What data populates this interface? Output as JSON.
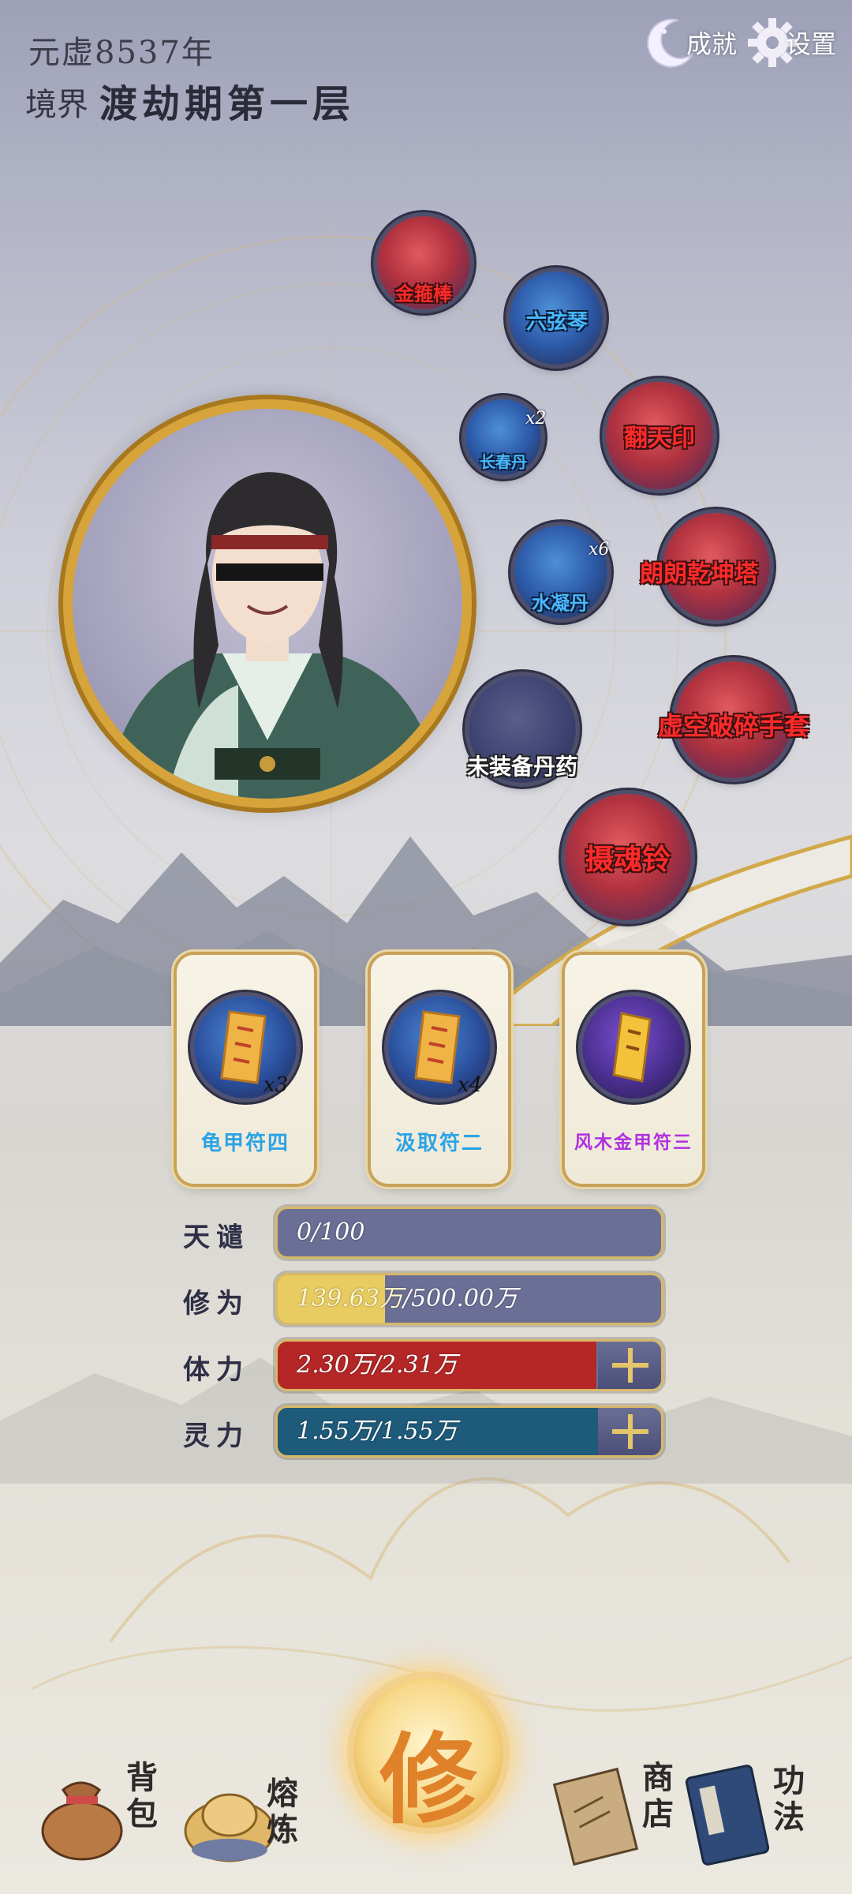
{
  "header": {
    "year": "元虚8537年",
    "realm_label": "境界",
    "realm_value": "渡劫期第一层",
    "achievements_label": "成就",
    "settings_label": "设置"
  },
  "equipment": [
    {
      "name": "金箍棒",
      "style": "red",
      "count": ""
    },
    {
      "name": "六弦琴",
      "style": "blue",
      "count": ""
    },
    {
      "name": "长春丹",
      "style": "blue",
      "count": "x2"
    },
    {
      "name": "翻天印",
      "style": "red",
      "count": ""
    },
    {
      "name": "水凝丹",
      "style": "blue",
      "count": "x6"
    },
    {
      "name": "朗朗乾坤塔",
      "style": "red",
      "count": ""
    },
    {
      "name": "未装备丹药",
      "style": "white",
      "count": ""
    },
    {
      "name": "虚空破碎手套",
      "style": "red",
      "count": ""
    },
    {
      "name": "摄魂铃",
      "style": "red",
      "count": ""
    }
  ],
  "talismans": [
    {
      "name": "龟甲符四",
      "count": "x3",
      "color": "#2aa3e6"
    },
    {
      "name": "汲取符二",
      "count": "x4",
      "color": "#2aa3e6"
    },
    {
      "name": "风木金甲符三",
      "count": "",
      "color": "#b02fe0"
    }
  ],
  "stats": [
    {
      "label": "天谴",
      "value": "0/100",
      "fraction": 0,
      "color": "#6c6f95",
      "fill": "#6c6f95",
      "plus": false
    },
    {
      "label": "修为",
      "value_a": "139.63万",
      "value_b": "/500.00万",
      "fraction": 0.28,
      "color": "#6c6f95",
      "fill": "#e8cc62",
      "plus": false
    },
    {
      "label": "体力",
      "value": "2.30万/2.31万",
      "fraction": 0.995,
      "color": "#b02a2a",
      "fill": "#b52626",
      "plus": true
    },
    {
      "label": "灵力",
      "value": "1.55万/1.55万",
      "fraction": 1.0,
      "color": "#1e5a7a",
      "fill": "#1e5a7a",
      "plus": true
    }
  ],
  "nav": {
    "bag": "背包",
    "smelt": "熔炼",
    "cultivate": "修",
    "shop": "商店",
    "skills": "功法"
  }
}
